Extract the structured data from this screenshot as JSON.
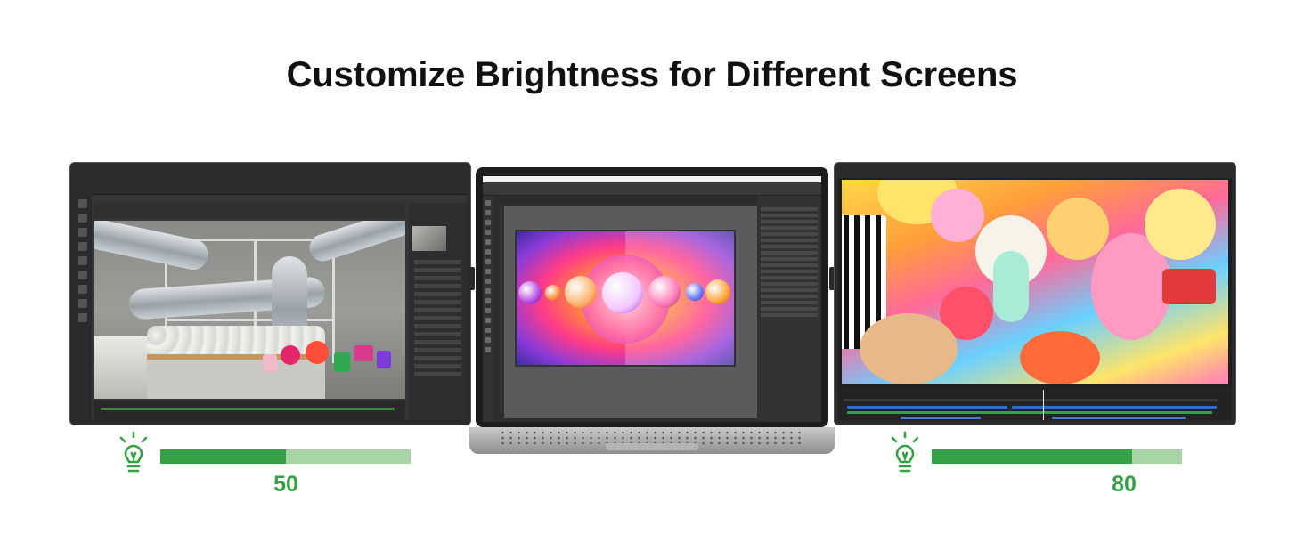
{
  "title": "Customize Brightness for Different Screens",
  "accent_color": "#35a045",
  "track_color": "#a8d5a5",
  "left_screen": {
    "icon": "lightbulb-icon",
    "brightness_value": "50",
    "brightness_fraction": 0.5
  },
  "right_screen": {
    "icon": "lightbulb-icon",
    "brightness_value": "80",
    "brightness_fraction": 0.8
  }
}
